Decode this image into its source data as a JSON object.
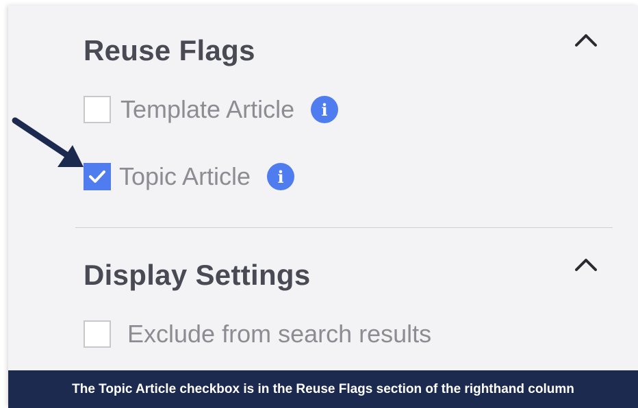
{
  "reuse_flags": {
    "title": "Reuse Flags",
    "toggle_icon": "chevron-up-icon",
    "options": [
      {
        "label": "Template Article",
        "checked": false,
        "info_icon": "info-icon"
      },
      {
        "label": "Topic Article",
        "checked": true,
        "info_icon": "info-icon"
      }
    ]
  },
  "display_settings": {
    "title": "Display Settings",
    "toggle_icon": "chevron-up-icon",
    "options": [
      {
        "label": "Exclude from search results",
        "checked": false
      }
    ]
  },
  "annotation": {
    "arrow_icon": "pointer-arrow-icon",
    "caption": "The Topic Article checkbox is in the Reuse Flags section of the righthand column"
  },
  "colors": {
    "accent": "#4f7df0",
    "caption_background": "#1c2a4f",
    "arrow": "#1c2a4f",
    "heading": "#4a4a54",
    "label": "#8c8c92"
  }
}
